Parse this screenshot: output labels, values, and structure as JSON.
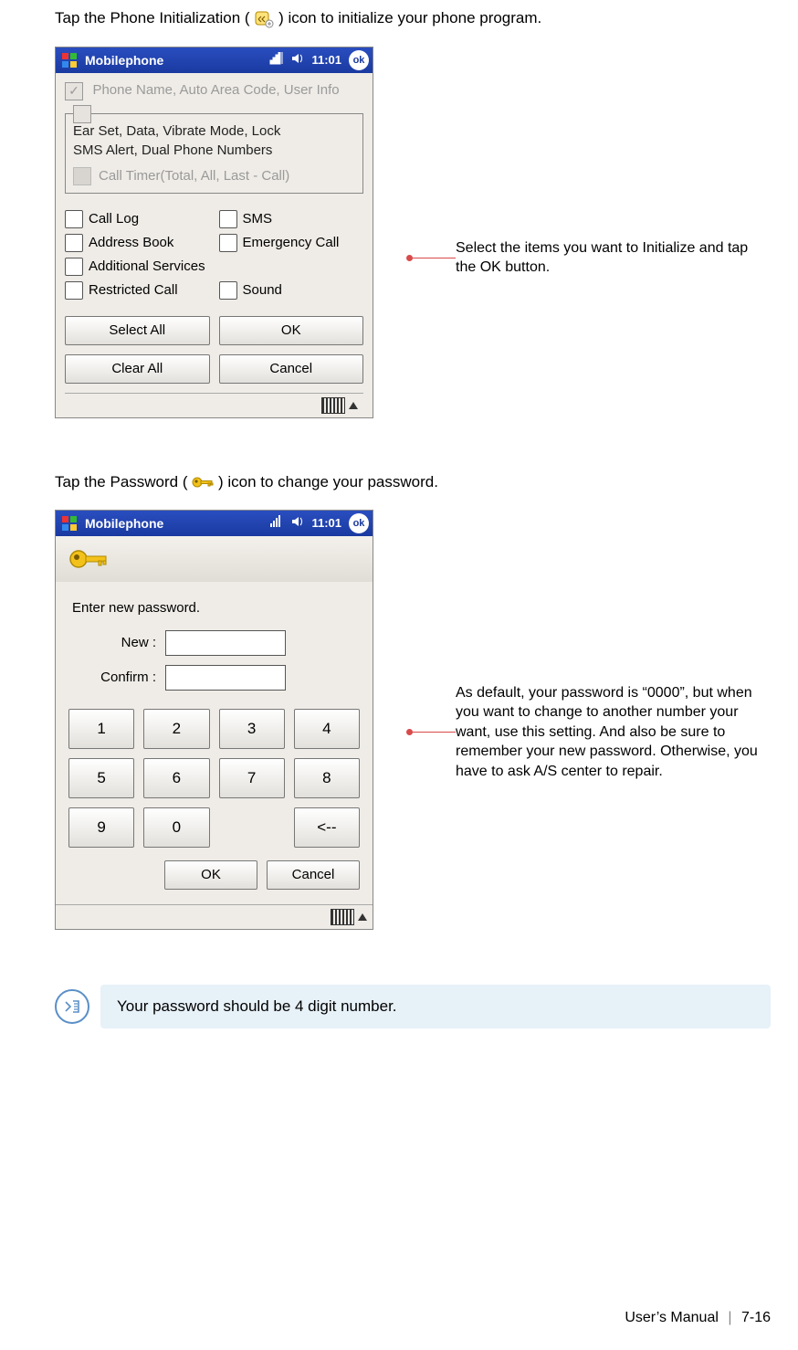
{
  "intro1_a": "Tap the Phone Initialization (",
  "intro1_b": ") icon to initialize your phone program.",
  "intro2_a": "Tap the Password (",
  "intro2_b": ") icon to change your password.",
  "annotation1": "Select the items you want to Initialize and tap the OK button.",
  "annotation2": "As default, your password is “0000”, but when you want to change to another number your want, use this setting. And also be sure to remember your new password. Otherwise, you have to ask A/S center to repair.",
  "note": "Your password should be 4 digit number.",
  "footer_label": "User’s Manual",
  "footer_page": "7-16",
  "screen1": {
    "title": "Mobilephone",
    "clock": "11:01",
    "ok_badge": "ok",
    "disabled_header": "Phone Name, Auto Area Code, User Info",
    "group_line1": "Ear Set, Data, Vibrate Mode,  Lock",
    "group_line2": "SMS Alert, Dual Phone Numbers",
    "group_disabled": "Call Timer(Total, All, Last - Call)",
    "items": {
      "c1": "Call Log",
      "c2": "SMS",
      "c3": "Address Book",
      "c4": "Emergency Call",
      "c5": "Additional Services",
      "c6": "Restricted Call",
      "c7": "Sound"
    },
    "buttons": {
      "select_all": "Select All",
      "ok": "OK",
      "clear_all": "Clear All",
      "cancel": "Cancel"
    }
  },
  "screen2": {
    "title": "Mobilephone",
    "clock": "11:01",
    "ok_badge": "ok",
    "prompt": "Enter new password.",
    "label_new": "New :",
    "label_confirm": "Confirm :",
    "keys": {
      "k1": "1",
      "k2": "2",
      "k3": "3",
      "k4": "4",
      "k5": "5",
      "k6": "6",
      "k7": "7",
      "k8": "8",
      "k9": "9",
      "k0": "0",
      "back": "<--"
    },
    "ok": "OK",
    "cancel": "Cancel"
  }
}
